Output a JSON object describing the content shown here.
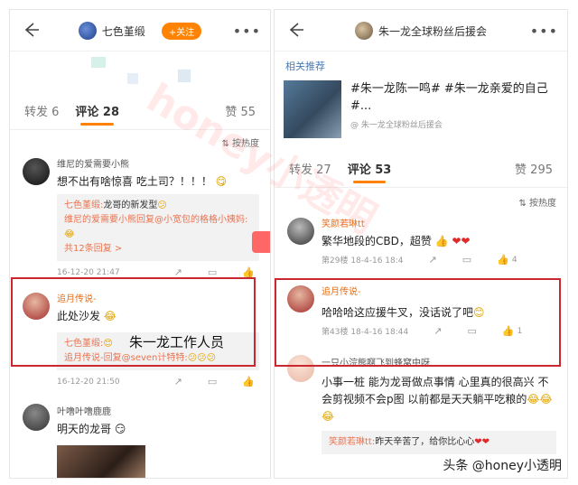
{
  "left": {
    "title": "七色堇缎",
    "follow_label": "+关注",
    "tabs": {
      "repost": "转发 6",
      "comments": "评论 28",
      "likes": "赞 55"
    },
    "sort_label": "按热度",
    "comments": [
      {
        "name": "维尼的爱需要小熊",
        "text": "想不出有啥惊喜 吃土司？！！！",
        "reply_line1_user": "七色堇缎:",
        "reply_line1_text": "龙哥的新发型",
        "reply_line2": "维尼的爱需要小熊回复@小宽包的格格小姨妈:",
        "more": "共12条回复 >",
        "time": "16-12-20 21:47"
      },
      {
        "name": "追月传说-",
        "text": "此处沙发",
        "reply_line1_user": "七色堇缎:",
        "reply_line2": "追月传说-回复@seven计特特:",
        "time": "16-12-20 21:50"
      },
      {
        "name": "叶噜叶噜鹿鹿",
        "text": "明天的龙哥"
      }
    ],
    "overlay_label": "朱一龙工作人员"
  },
  "right": {
    "title": "朱一龙全球粉丝后援会",
    "related": "相关推荐",
    "topic_text": "#朱一龙陈一鸣# #朱一龙亲爱的自己#...",
    "topic_source": "@ 朱一龙全球粉丝后援会",
    "tabs": {
      "repost": "转发 27",
      "comments": "评论 53",
      "likes": "赞 295"
    },
    "sort_label": "按热度",
    "comments": [
      {
        "name": "笑颜若琳tt",
        "text": "繁华地段的CBD，超赞",
        "time": "第29楼 18-4-16 18:4",
        "likes": "4"
      },
      {
        "name": "追月传说-",
        "text": "哈哈哈这应援牛叉，没话说了吧",
        "time": "第43楼 18-4-16 18:44",
        "likes": "1"
      },
      {
        "name": "一只小浣熊啊飞到蜂窝中呀",
        "text": "小事一桩 能为龙哥做点事情 心里真的很高兴 不会剪视频不会p图 以前都是天天躺平吃粮的",
        "reply_user": "笑颜若琳tt:",
        "reply_text": "昨天辛苦了，给你比心心"
      }
    ]
  },
  "watermark": "honey小透明",
  "footer_mark": "头条 @honey小透明"
}
